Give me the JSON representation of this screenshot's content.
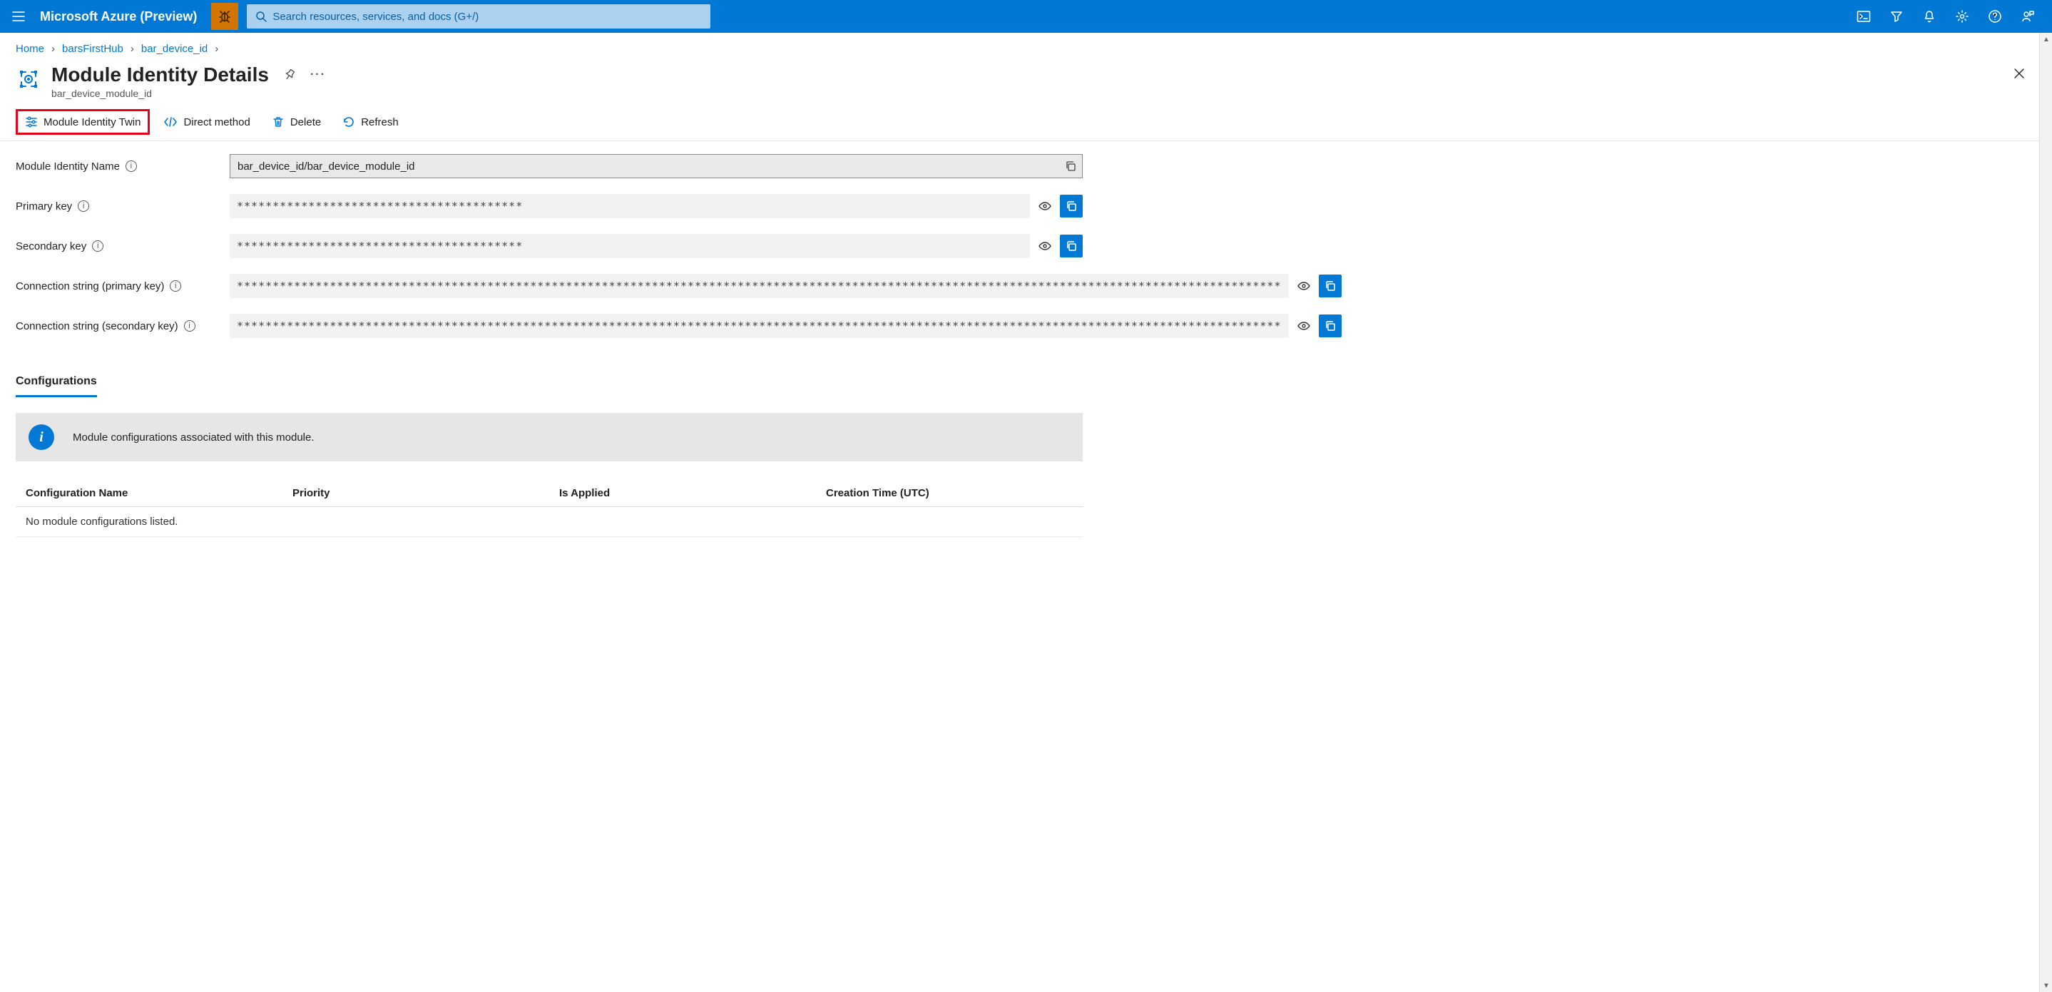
{
  "brand": "Microsoft Azure (Preview)",
  "search_placeholder": "Search resources, services, and docs (G+/)",
  "breadcrumb": {
    "home": "Home",
    "hub": "barsFirstHub",
    "device": "bar_device_id"
  },
  "page": {
    "title": "Module Identity Details",
    "subtitle": "bar_device_module_id"
  },
  "commands": {
    "twin": "Module Identity Twin",
    "direct": "Direct method",
    "delete": "Delete",
    "refresh": "Refresh"
  },
  "fields": {
    "name_label": "Module Identity Name",
    "name_value": "bar_device_id/bar_device_module_id",
    "primary_label": "Primary key",
    "primary_mask": "****************************************",
    "secondary_label": "Secondary key",
    "secondary_mask": "****************************************",
    "conn_primary_label": "Connection string (primary key)",
    "conn_primary_mask": "**************************************************************************************************************************************************",
    "conn_secondary_label": "Connection string (secondary key)",
    "conn_secondary_mask": "**************************************************************************************************************************************************"
  },
  "tabs": {
    "config": "Configurations"
  },
  "info_text": "Module configurations associated with this module.",
  "table": {
    "headers": {
      "name": "Configuration Name",
      "priority": "Priority",
      "applied": "Is Applied",
      "created": "Creation Time (UTC)"
    },
    "empty": "No module configurations listed."
  }
}
